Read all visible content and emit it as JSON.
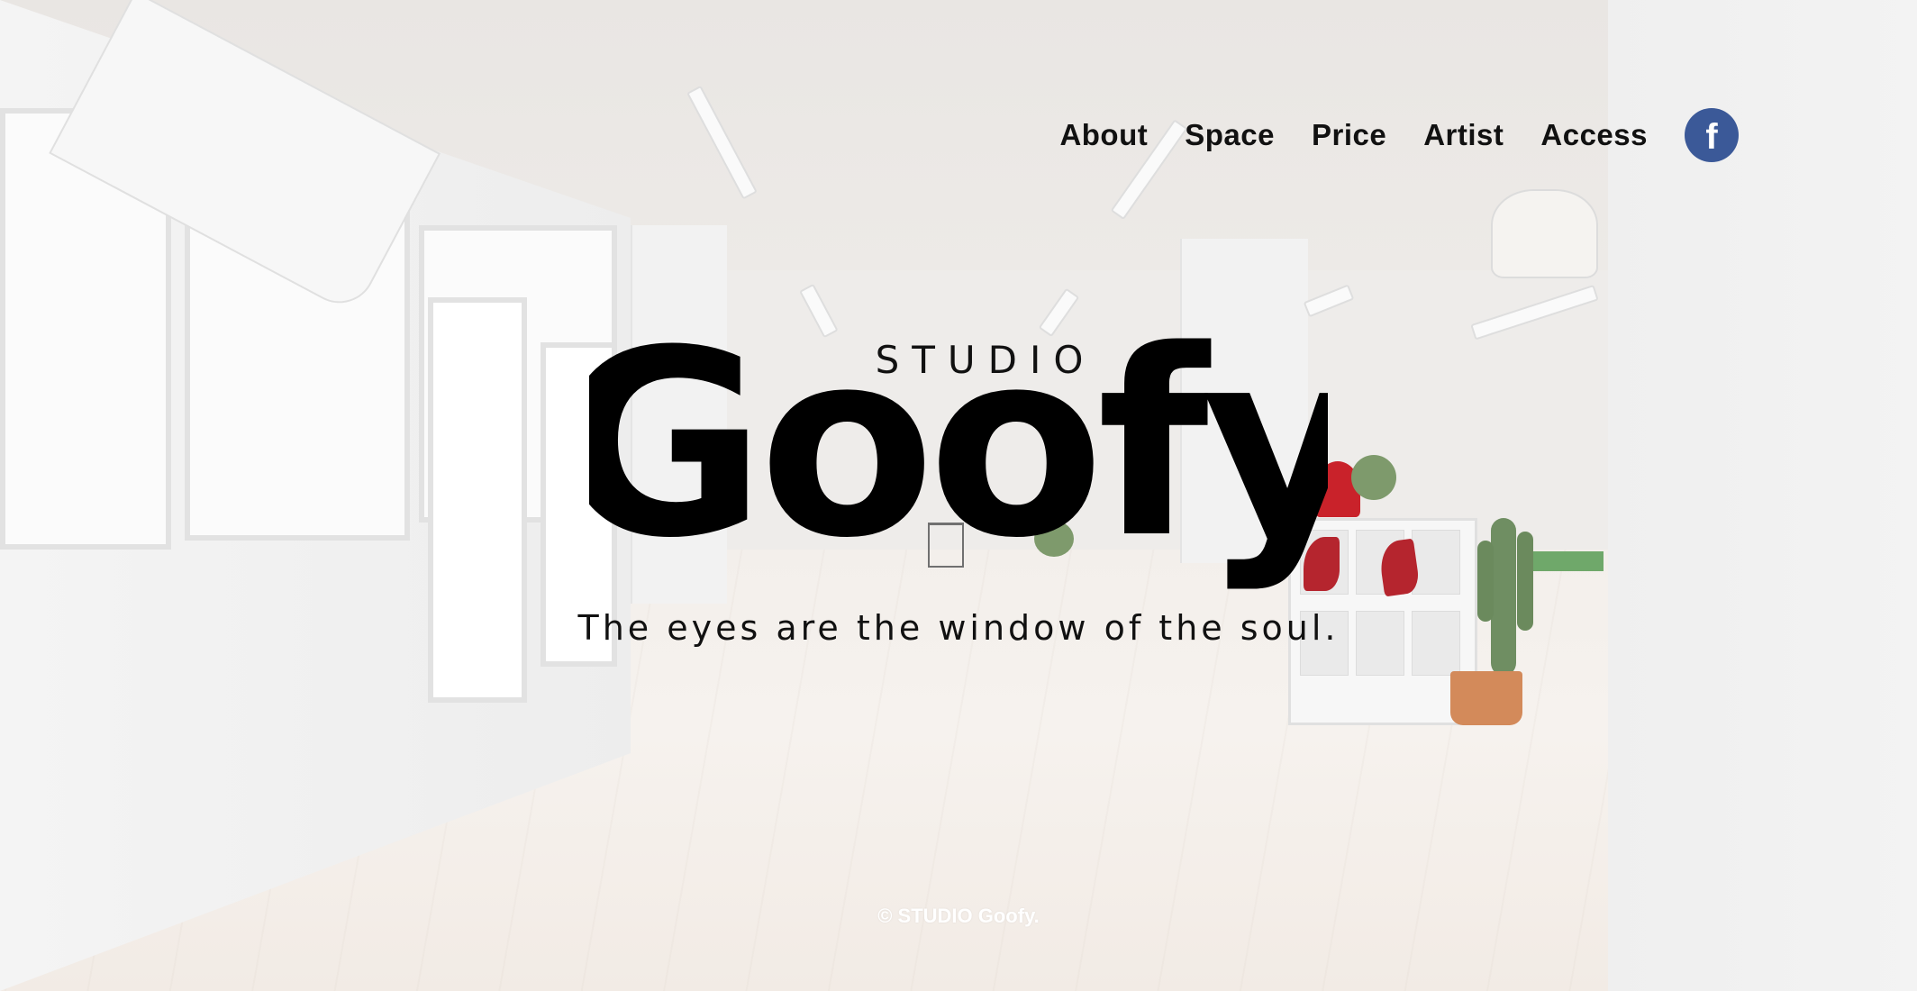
{
  "nav": {
    "items": [
      {
        "label": "About"
      },
      {
        "label": "Space"
      },
      {
        "label": "Price"
      },
      {
        "label": "Artist"
      },
      {
        "label": "Access"
      }
    ],
    "social_icon": "facebook-icon",
    "social_glyph": "f",
    "social_color": "#3b5998"
  },
  "hero": {
    "studio": "STUDIO",
    "logo": "Goofy",
    "tagline": "The eyes are the window of the soul."
  },
  "footer": {
    "copyright": "© STUDIO Goofy."
  }
}
